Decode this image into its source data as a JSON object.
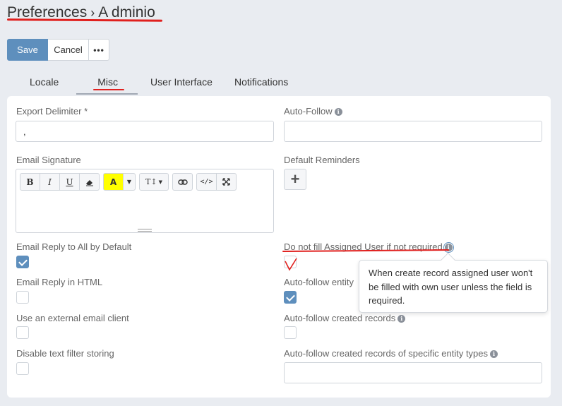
{
  "header": {
    "breadcrumb_root": "Preferences",
    "separator": "›",
    "user": "A dminio"
  },
  "toolbar": {
    "save_label": "Save",
    "cancel_label": "Cancel",
    "more_label": "•••"
  },
  "tabs": [
    {
      "label": "Locale"
    },
    {
      "label": "Misc",
      "active": true
    },
    {
      "label": "User Interface"
    },
    {
      "label": "Notifications"
    }
  ],
  "fields": {
    "export_delimiter": {
      "label": "Export Delimiter *",
      "value": ","
    },
    "auto_follow": {
      "label": "Auto-Follow",
      "value": ""
    },
    "email_signature": {
      "label": "Email Signature"
    },
    "default_reminders": {
      "label": "Default Reminders",
      "add_label": "+"
    },
    "email_reply_all": {
      "label": "Email Reply to All by Default",
      "checked": true
    },
    "dnf_assigned_user": {
      "label": "Do not fill Assigned User if not required",
      "checked": false
    },
    "email_reply_html": {
      "label": "Email Reply in HTML",
      "checked": false
    },
    "auto_follow_entity": {
      "label": "Auto-follow entity",
      "checked": true
    },
    "external_email": {
      "label": "Use an external email client",
      "checked": false
    },
    "auto_follow_created": {
      "label": "Auto-follow created records",
      "checked": false
    },
    "disable_text_filter": {
      "label": "Disable text filter storing",
      "checked": false
    },
    "auto_follow_specific": {
      "label": "Auto-follow created records of specific entity types",
      "value": ""
    }
  },
  "editor_toolbar": {
    "bold": "B",
    "italic": "I",
    "underline": "U",
    "color": "A",
    "font_size": "T↕"
  },
  "tooltip": {
    "text": "When create record assigned user won't be filled with own user unless the field is required."
  },
  "colors": {
    "primary": "#5e8fbd",
    "annotation_red": "#e0201e",
    "highlight_yellow": "#ffff00"
  }
}
